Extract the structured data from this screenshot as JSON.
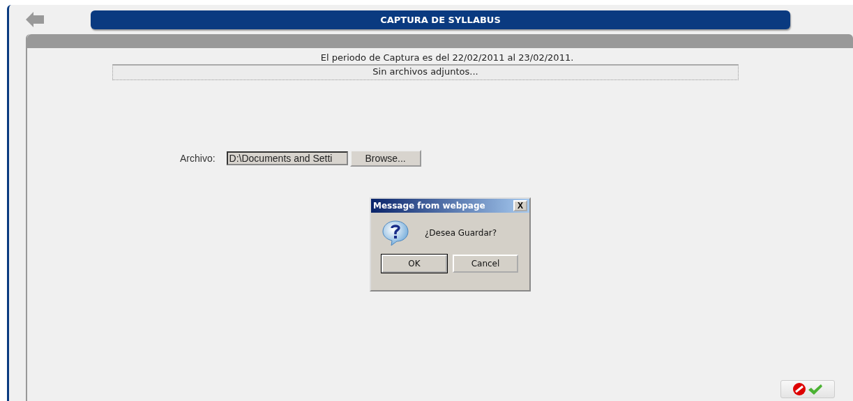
{
  "header": {
    "title": "CAPTURA DE SYLLABUS"
  },
  "period_text": "El periodo de Captura es del 22/02/2011 al 23/02/2011.",
  "attachments_status": "Sin archivos adjuntos...",
  "file_field": {
    "label": "Archivo:",
    "value": "D:\\Documents and Setti",
    "button": "Browse..."
  },
  "dialog": {
    "title": "Message from webpage",
    "close": "X",
    "message": "¿Desea Guardar?",
    "buttons": [
      {
        "label": "OK",
        "selected": true
      },
      {
        "label": "Cancel",
        "selected": false
      }
    ]
  }
}
